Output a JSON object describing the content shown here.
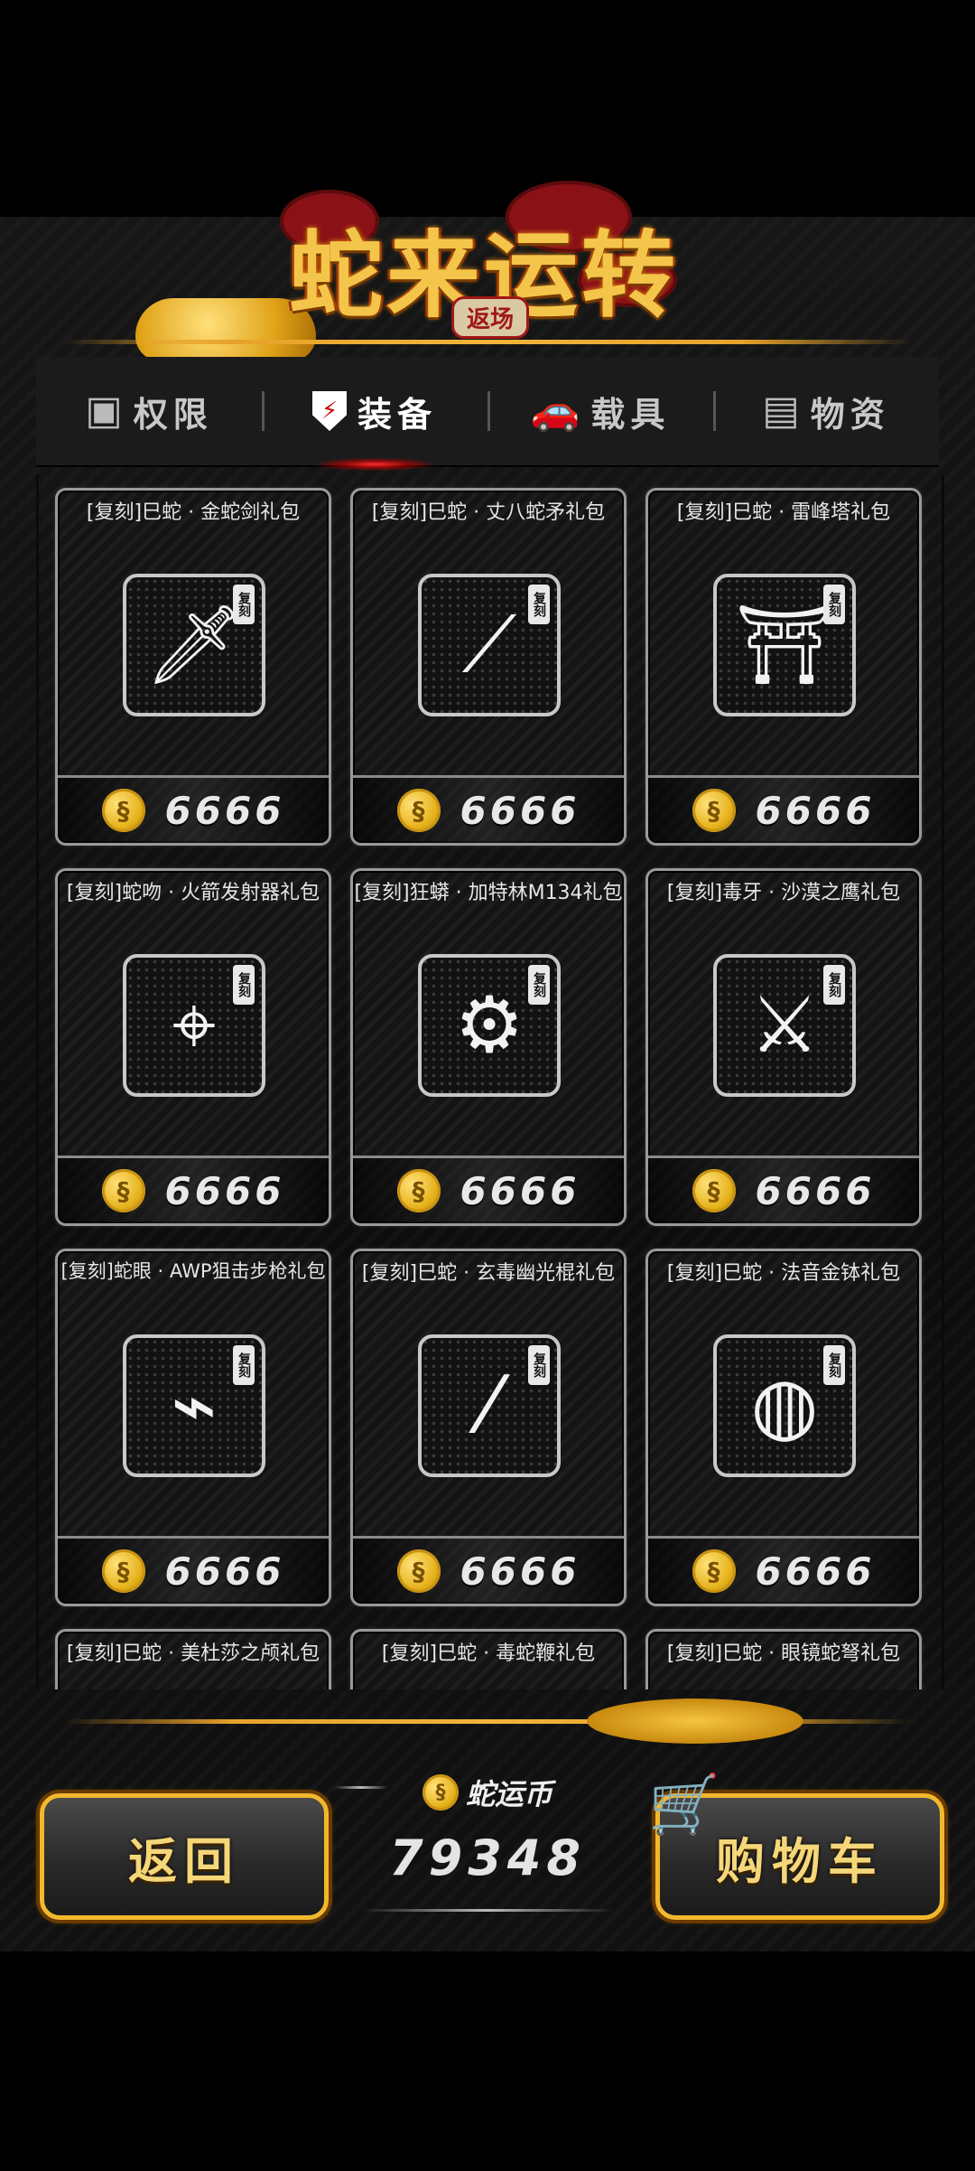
{
  "header": {
    "title": "蛇来运转",
    "badge": "返场"
  },
  "tabs": [
    {
      "label": "权限",
      "icon": "box-icon",
      "active": false
    },
    {
      "label": "装备",
      "icon": "shield-icon",
      "active": true
    },
    {
      "label": "载具",
      "icon": "car-icon",
      "active": false
    },
    {
      "label": "物资",
      "icon": "crate-icon",
      "active": false
    }
  ],
  "items": [
    {
      "name": "[复刻]巳蛇 · 金蛇剑礼包",
      "tag": "复刻",
      "price": "6666",
      "icon": "sword-icon"
    },
    {
      "name": "[复刻]巳蛇 · 丈八蛇矛礼包",
      "tag": "复刻",
      "price": "6666",
      "icon": "spear-icon"
    },
    {
      "name": "[复刻]巳蛇 · 雷峰塔礼包",
      "tag": "复刻",
      "price": "6666",
      "icon": "pagoda-icon"
    },
    {
      "name": "[复刻]蛇吻 · 火箭发射器礼包",
      "tag": "复刻",
      "price": "6666",
      "icon": "rocket-launcher-icon"
    },
    {
      "name": "[复刻]狂蟒 · 加特林M134礼包",
      "tag": "复刻",
      "price": "6666",
      "icon": "gatling-icon"
    },
    {
      "name": "[复刻]毒牙 · 沙漠之鹰礼包",
      "tag": "复刻",
      "price": "6666",
      "icon": "pistol-icon"
    },
    {
      "name": "[复刻]蛇眼 · AWP狙击步枪礼包",
      "tag": "复刻",
      "price": "6666",
      "icon": "sniper-rifle-icon"
    },
    {
      "name": "[复刻]巳蛇 · 玄毒幽光棍礼包",
      "tag": "复刻",
      "price": "6666",
      "icon": "staff-icon"
    },
    {
      "name": "[复刻]巳蛇 · 法音金钵礼包",
      "tag": "复刻",
      "price": "6666",
      "icon": "bowl-icon"
    },
    {
      "name": "[复刻]巳蛇 · 美杜莎之颅礼包",
      "tag": "复刻",
      "price": "",
      "icon": ""
    },
    {
      "name": "[复刻]巳蛇 · 毒蛇鞭礼包",
      "tag": "复刻",
      "price": "",
      "icon": ""
    },
    {
      "name": "[复刻]巳蛇 · 眼镜蛇弩礼包",
      "tag": "复刻",
      "price": "",
      "icon": ""
    }
  ],
  "footer": {
    "back_label": "返回",
    "currency_label": "蛇运币",
    "currency_value": "79348",
    "cart_label": "购物车"
  }
}
